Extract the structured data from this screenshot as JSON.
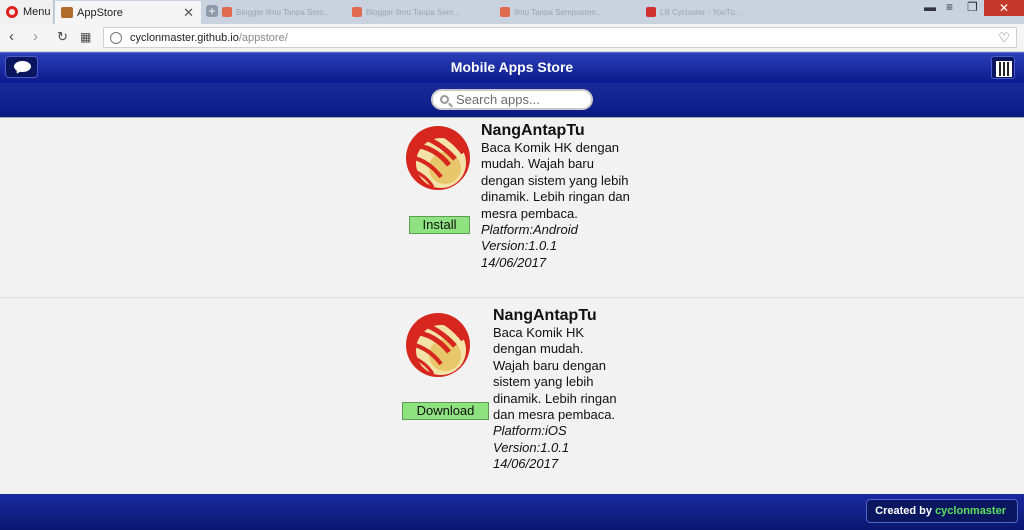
{
  "browser": {
    "menu_label": "Menu",
    "active_tab": "AppStore",
    "background_tabs": [
      "Blogger Ilmu Tanpa Sem...",
      "Blogger Ilmu Tanpa Sem...",
      "Ilmu Tanpa Semposten...",
      "Lili Cycloster - YouTu..."
    ],
    "url_host": "cyclonmaster.github.io",
    "url_path": "/appstore/"
  },
  "header": {
    "title": "Mobile Apps Store"
  },
  "search": {
    "placeholder": "Search apps..."
  },
  "apps": [
    {
      "name": "NangAntapTu",
      "description": "Baca Komik HK dengan mudah. Wajah baru dengan sistem yang lebih dinamik. Lebih ringan dan mesra pembaca.",
      "platform": "Platform:Android",
      "version": "Version:1.0.1",
      "date": "14/06/2017",
      "button": "Install"
    },
    {
      "name": "NangAntapTu",
      "description": "Baca Komik HK dengan mudah. Wajah baru dengan sistem yang lebih dinamik. Lebih ringan dan mesra pembaca.",
      "platform": "Platform:iOS",
      "version": "Version:1.0.1",
      "date": "14/06/2017",
      "button": "Download"
    }
  ],
  "footer": {
    "created_by": "Created by",
    "author": "cyclonmaster"
  },
  "colors": {
    "header_blue": "#0b1a8c",
    "button_green": "#8ee27f",
    "author_green": "#5be05b",
    "logo_red": "#d7261e"
  },
  "icons": {
    "chat": "chat-bubble-icon",
    "qr": "qr-code-icon",
    "search": "search-icon",
    "app_logo": "app-logo-icon"
  }
}
